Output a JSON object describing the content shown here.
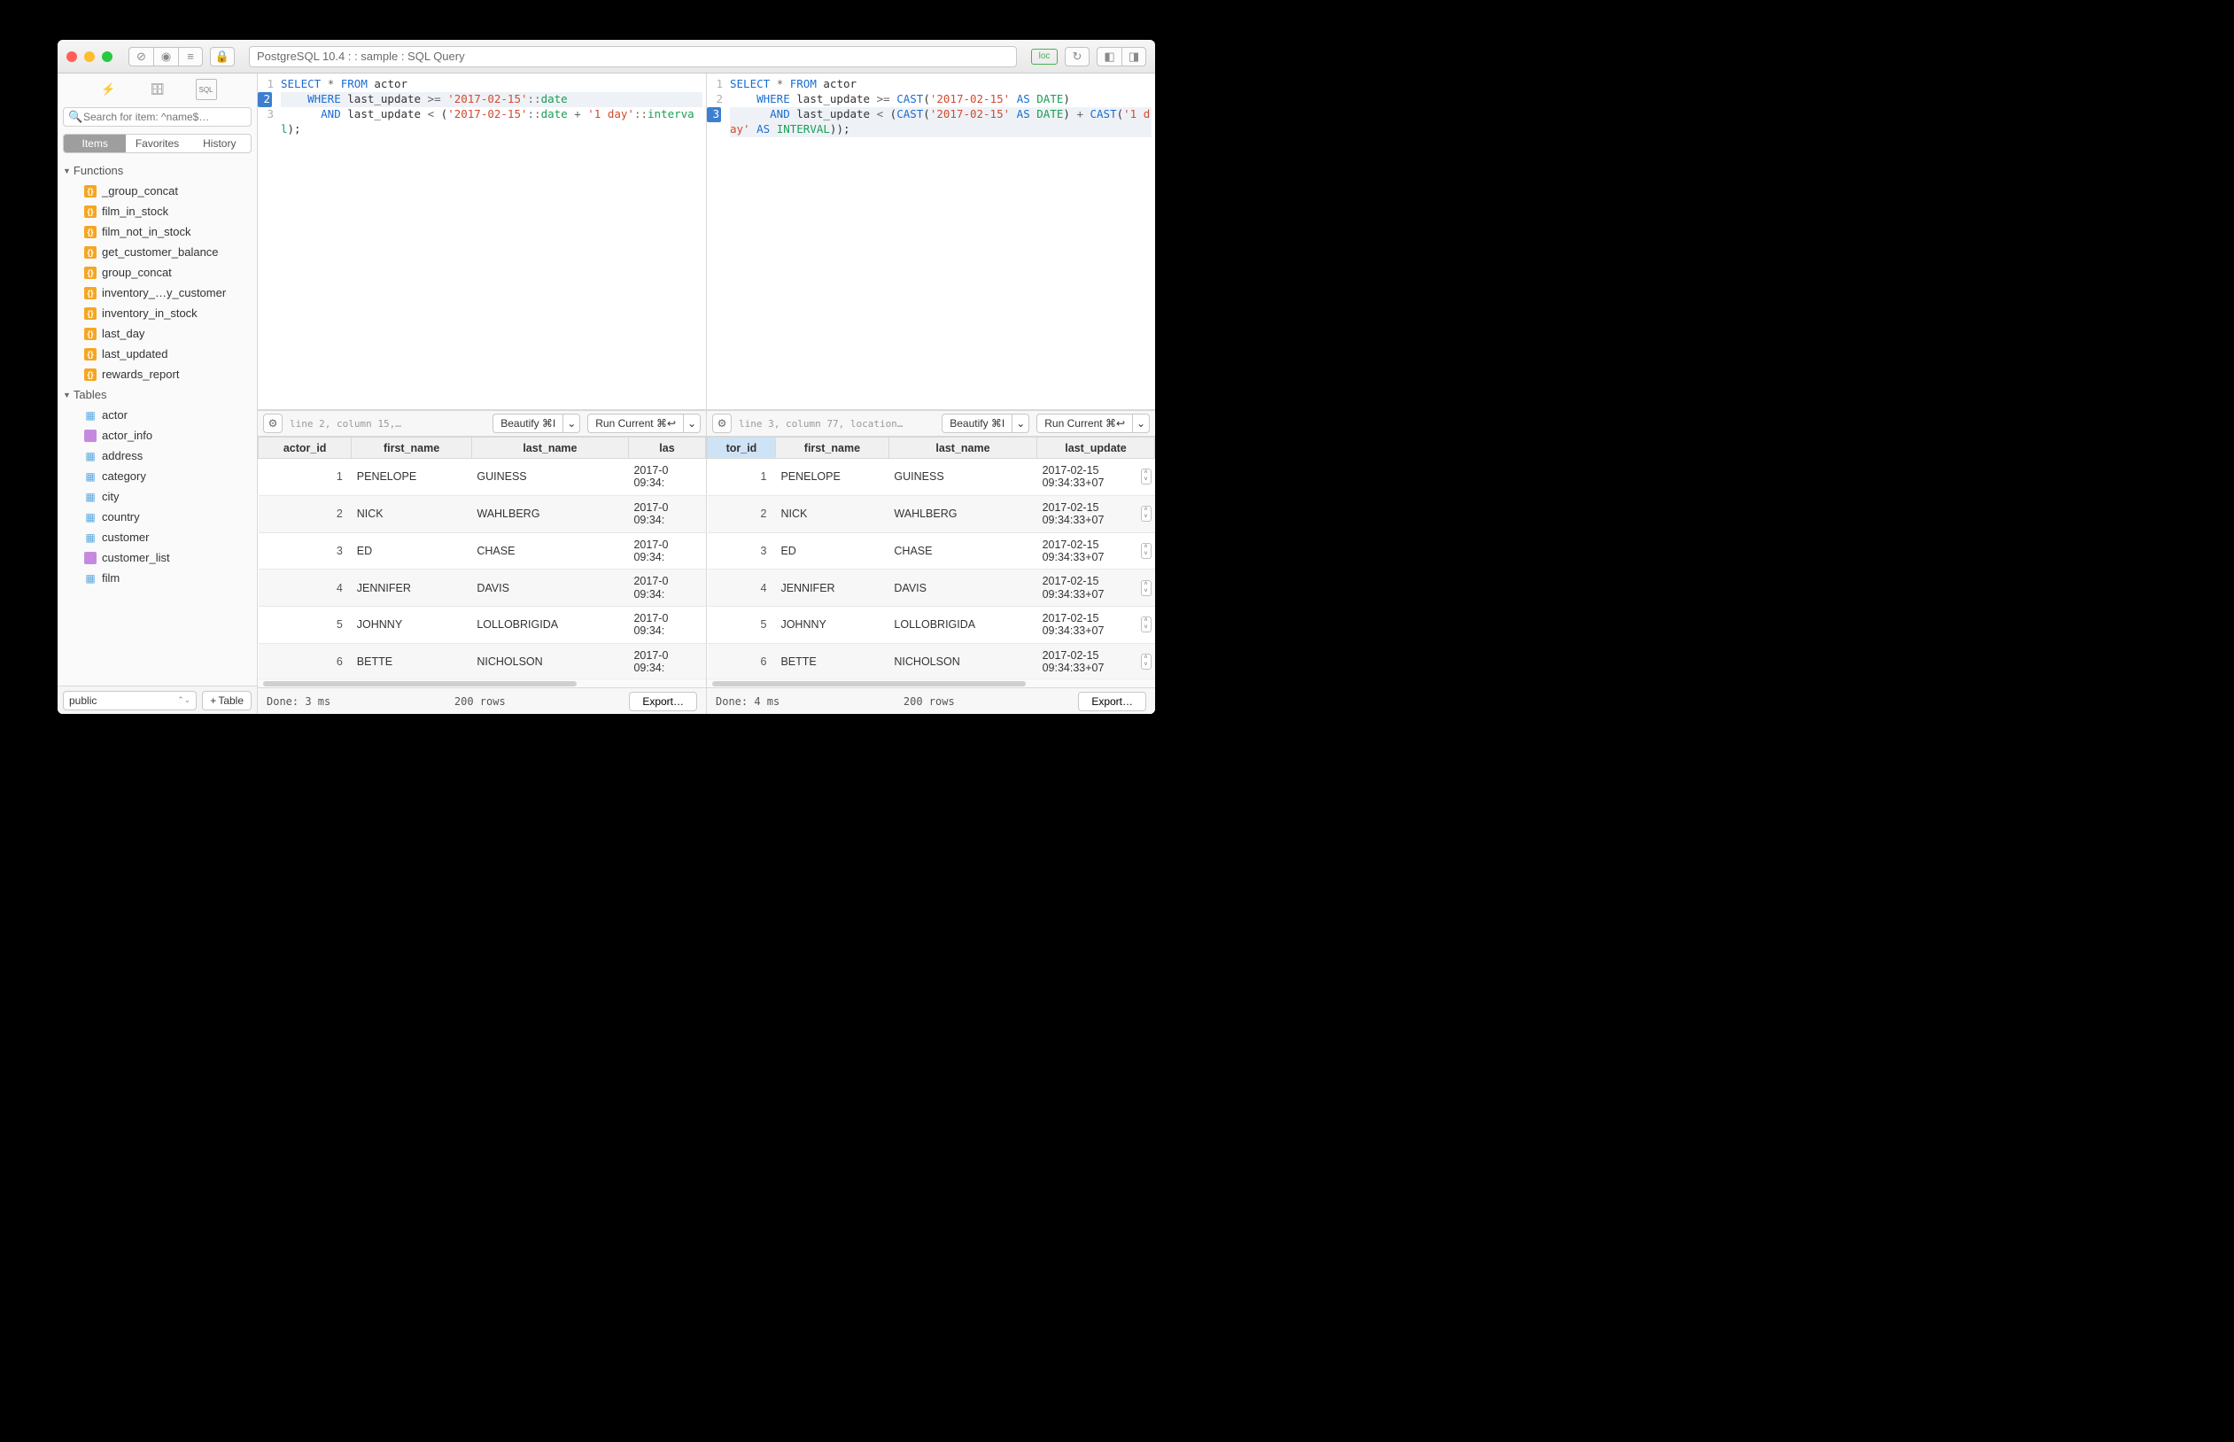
{
  "titlebar": {
    "title": "PostgreSQL 10.4 :  : sample : SQL Query",
    "loc_badge": "loc"
  },
  "sidebar": {
    "search_placeholder": "Search for item: ^name$…",
    "tabs": {
      "items": "Items",
      "favorites": "Favorites",
      "history": "History"
    },
    "groups": {
      "functions_label": "Functions",
      "tables_label": "Tables",
      "functions": [
        "_group_concat",
        "film_in_stock",
        "film_not_in_stock",
        "get_customer_balance",
        "group_concat",
        "inventory_…y_customer",
        "inventory_in_stock",
        "last_day",
        "last_updated",
        "rewards_report"
      ],
      "tables": [
        {
          "name": "actor",
          "kind": "table"
        },
        {
          "name": "actor_info",
          "kind": "view"
        },
        {
          "name": "address",
          "kind": "table"
        },
        {
          "name": "category",
          "kind": "table"
        },
        {
          "name": "city",
          "kind": "table"
        },
        {
          "name": "country",
          "kind": "table"
        },
        {
          "name": "customer",
          "kind": "table"
        },
        {
          "name": "customer_list",
          "kind": "view"
        },
        {
          "name": "film",
          "kind": "table"
        }
      ]
    },
    "schema": "public",
    "add_table": "Table"
  },
  "left_pane": {
    "status": "line 2, column 15,…",
    "beautify": "Beautify ⌘I",
    "run": "Run Current ⌘↩",
    "columns": [
      "actor_id",
      "first_name",
      "last_name",
      "las"
    ],
    "rows": [
      {
        "id": "1",
        "fn": "PENELOPE",
        "ln": "GUINESS",
        "ts": "2017-0\n09:34:"
      },
      {
        "id": "2",
        "fn": "NICK",
        "ln": "WAHLBERG",
        "ts": "2017-0\n09:34:"
      },
      {
        "id": "3",
        "fn": "ED",
        "ln": "CHASE",
        "ts": "2017-0\n09:34:"
      },
      {
        "id": "4",
        "fn": "JENNIFER",
        "ln": "DAVIS",
        "ts": "2017-0\n09:34:"
      },
      {
        "id": "5",
        "fn": "JOHNNY",
        "ln": "LOLLOBRIGIDA",
        "ts": "2017-0\n09:34:"
      },
      {
        "id": "6",
        "fn": "BETTE",
        "ln": "NICHOLSON",
        "ts": "2017-0\n09:34:"
      }
    ],
    "done": "Done: 3 ms",
    "rowcount": "200 rows",
    "export": "Export…"
  },
  "right_pane": {
    "status": "line 3, column 77, location…",
    "beautify": "Beautify ⌘I",
    "run": "Run Current ⌘↩",
    "columns": [
      "tor_id",
      "first_name",
      "last_name",
      "last_update"
    ],
    "rows": [
      {
        "id": "1",
        "fn": "PENELOPE",
        "ln": "GUINESS",
        "ts": "2017-02-15\n09:34:33+07"
      },
      {
        "id": "2",
        "fn": "NICK",
        "ln": "WAHLBERG",
        "ts": "2017-02-15\n09:34:33+07"
      },
      {
        "id": "3",
        "fn": "ED",
        "ln": "CHASE",
        "ts": "2017-02-15\n09:34:33+07"
      },
      {
        "id": "4",
        "fn": "JENNIFER",
        "ln": "DAVIS",
        "ts": "2017-02-15\n09:34:33+07"
      },
      {
        "id": "5",
        "fn": "JOHNNY",
        "ln": "LOLLOBRIGIDA",
        "ts": "2017-02-15\n09:34:33+07"
      },
      {
        "id": "6",
        "fn": "BETTE",
        "ln": "NICHOLSON",
        "ts": "2017-02-15\n09:34:33+07"
      }
    ],
    "done": "Done: 4 ms",
    "rowcount": "200 rows",
    "export": "Export…"
  }
}
